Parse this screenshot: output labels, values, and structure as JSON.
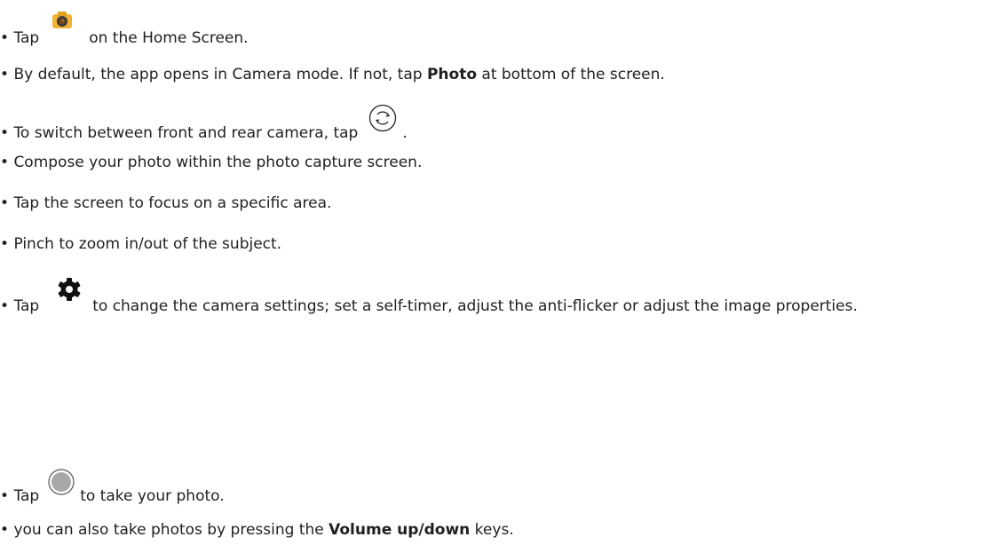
{
  "bullet": "•",
  "steps": [
    {
      "before": "Tap",
      "icon": "camera-app-icon",
      "after": "on the Home Screen."
    },
    {
      "before": "By default, the app opens in Camera mode. If not, tap ",
      "bold": "Photo",
      "after": " at bottom of the screen."
    },
    {
      "before": "To switch between front and rear camera, tap",
      "icon": "switch-camera-icon",
      "after": "."
    },
    {
      "text": "Compose your photo within the photo capture screen."
    },
    {
      "text": "Tap the screen to focus on a specific area."
    },
    {
      "text": "Pinch to zoom in/out of the subject."
    },
    {
      "before": "Tap",
      "icon": "gear-icon",
      "after": "to change the camera settings; set a self-timer, adjust the anti-flicker or adjust the image properties."
    },
    {
      "before": "Tap",
      "icon": "shutter-icon",
      "after": "to take your photo."
    },
    {
      "before": "you can also take photos by pressing the ",
      "bold": "Volume up/down",
      "after": " keys."
    }
  ],
  "colors": {
    "text": "#1f1f1f",
    "camera_icon_body": "#f2b233",
    "camera_icon_lens": "#3a3a3a",
    "shutter_fill": "#a8a8a8"
  }
}
